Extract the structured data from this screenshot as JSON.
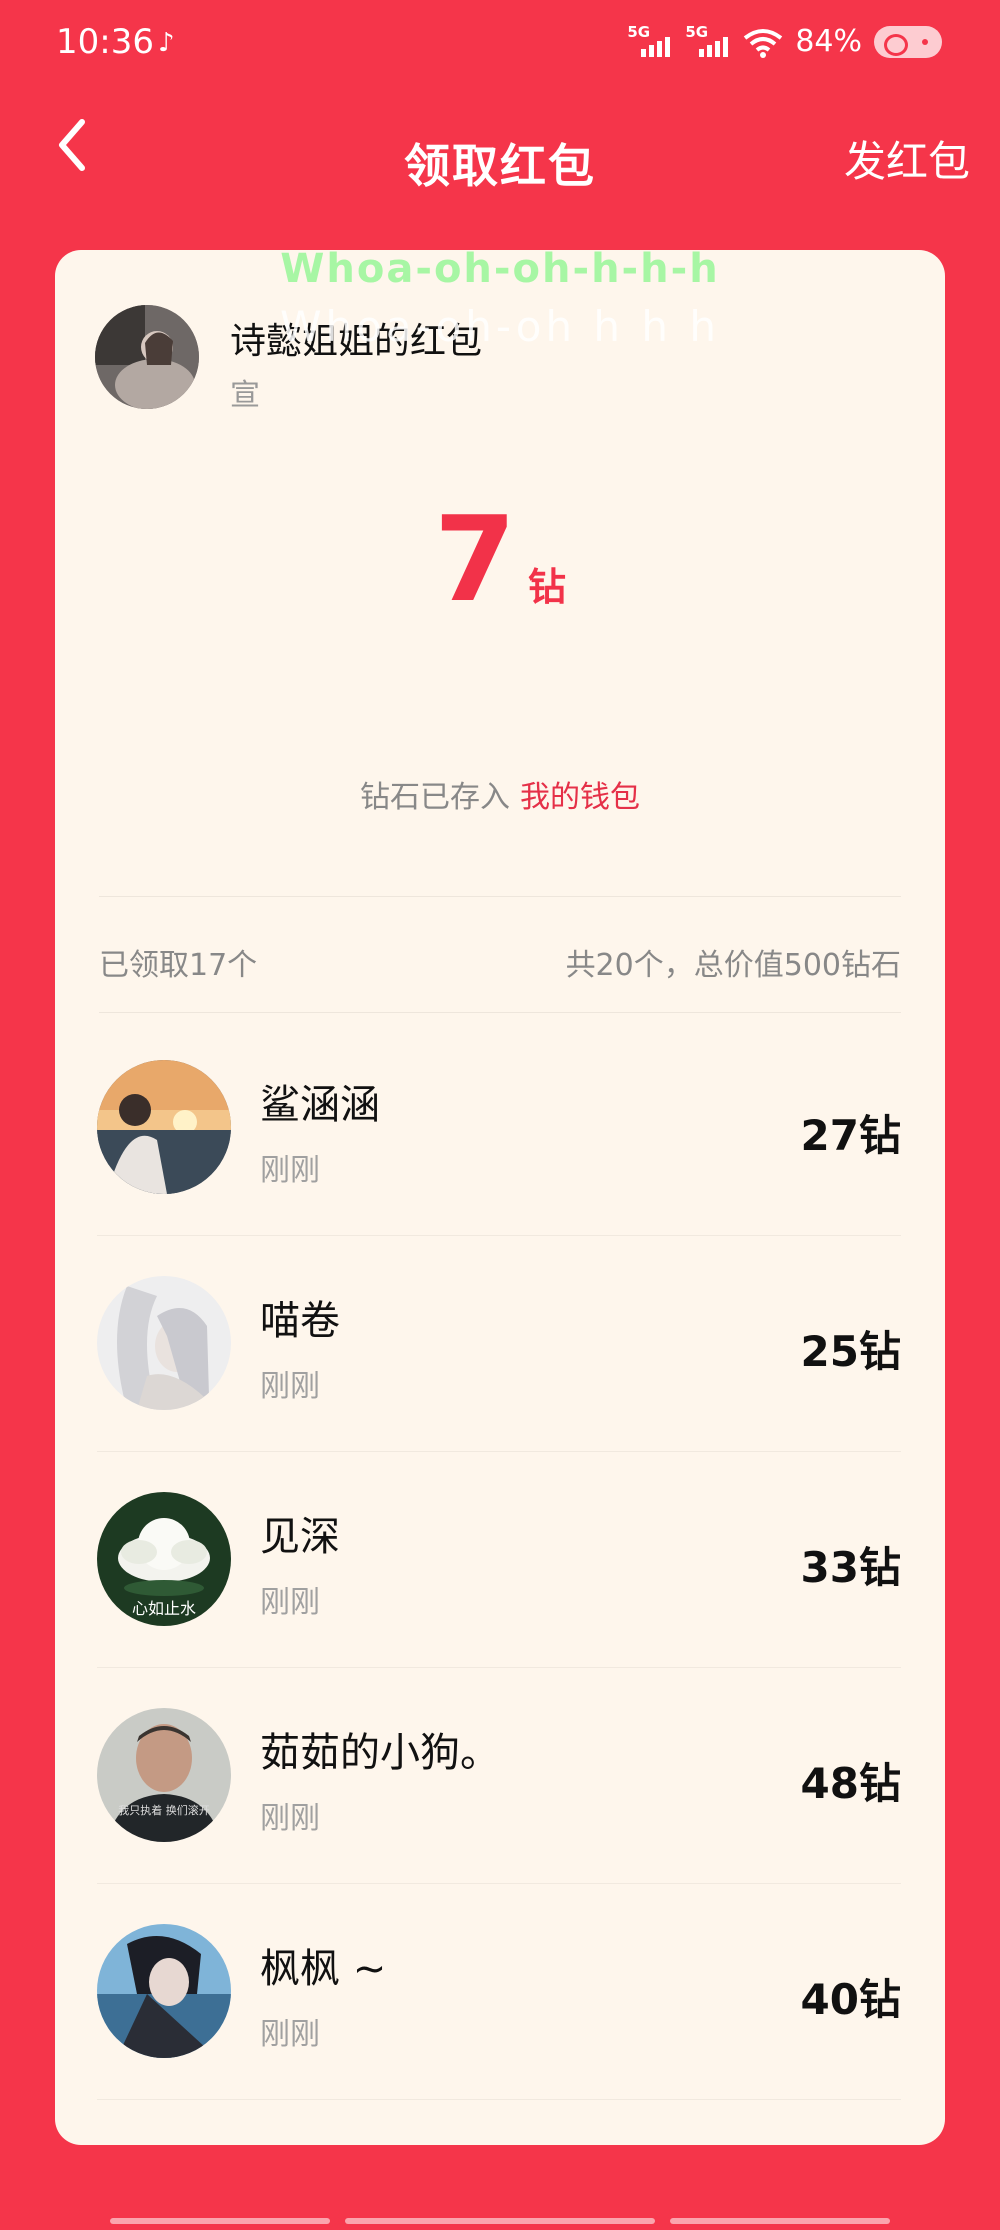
{
  "status_bar": {
    "time": "10:36",
    "note_icon": "music-note-icon",
    "signal_1": "5G",
    "signal_2": "5G",
    "battery": "84%"
  },
  "nav": {
    "title": "领取红包",
    "action": "发红包"
  },
  "lyrics": {
    "line1": "Whoa-oh-oh-h-h-h",
    "line2": "Whoa-oh-oh h h h"
  },
  "sender": {
    "name": "诗懿姐姐的红包",
    "sub": "宣"
  },
  "amount": {
    "value": "7",
    "unit": "钻"
  },
  "wallet": {
    "text": "钻石已存入",
    "link": "我的钱包"
  },
  "stats": {
    "claimed": "已领取17个",
    "total": "共20个，总价值500钻石"
  },
  "recipients": [
    {
      "name": "鲨涵涵",
      "time": "刚刚",
      "amount": "27钻"
    },
    {
      "name": "喵卷",
      "time": "刚刚",
      "amount": "25钻"
    },
    {
      "name": "见深",
      "time": "刚刚",
      "amount": "33钻",
      "avatar_text": "心如止水"
    },
    {
      "name": "茹茹的小狗。",
      "time": "刚刚",
      "amount": "48钻",
      "avatar_text": "我只执着 换们滚开"
    },
    {
      "name": "枫枫 ~",
      "time": "刚刚",
      "amount": "40钻"
    }
  ],
  "colors": {
    "background": "#f5354a",
    "card": "#fef6ec",
    "accent": "#f23249",
    "lyric": "#a7f6a4"
  }
}
